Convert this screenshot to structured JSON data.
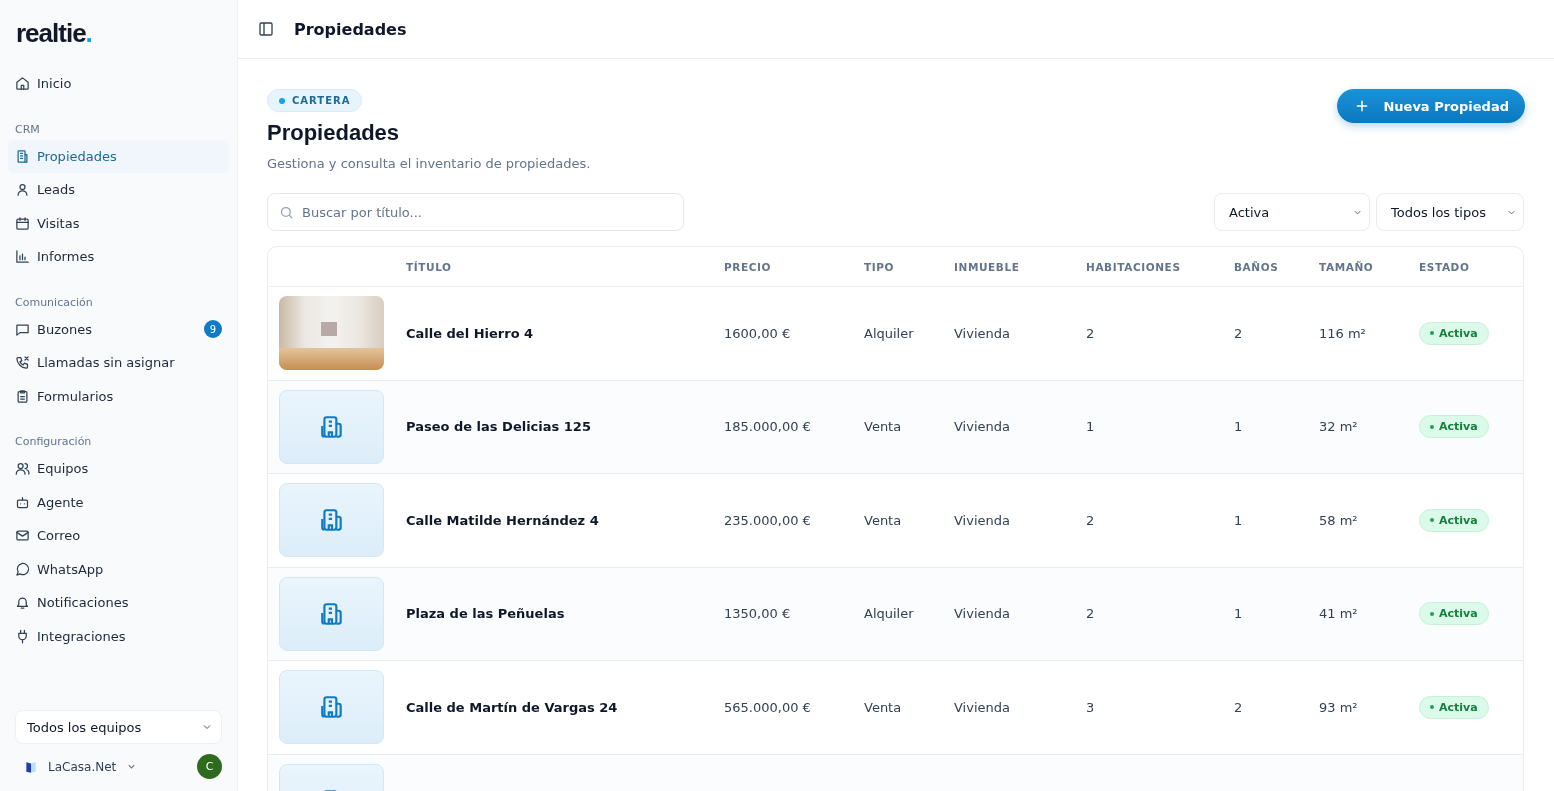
{
  "sidebar": {
    "logo": "realtie",
    "logo_dot": ".",
    "sections": [
      {
        "items": [
          {
            "label": "Inicio",
            "selected": false
          }
        ]
      },
      {
        "heading": "CRM",
        "items": [
          {
            "label": "Propiedades",
            "selected": true
          },
          {
            "label": "Leads",
            "selected": false
          },
          {
            "label": "Visitas",
            "selected": false
          },
          {
            "label": "Informes",
            "selected": false
          }
        ]
      },
      {
        "heading": "Comunicación",
        "items": [
          {
            "label": "Buzones",
            "selected": false,
            "badge": "9"
          },
          {
            "label": "Llamadas sin asignar",
            "selected": false
          },
          {
            "label": "Formularios",
            "selected": false
          }
        ]
      },
      {
        "heading": "Configuración",
        "items": [
          {
            "label": "Equipos",
            "selected": false
          },
          {
            "label": "Agente",
            "selected": false
          },
          {
            "label": "Correo",
            "selected": false
          },
          {
            "label": "WhatsApp",
            "selected": false
          },
          {
            "label": "Notificaciones",
            "selected": false
          },
          {
            "label": "Integraciones",
            "selected": false
          }
        ]
      }
    ],
    "team_select": {
      "value": "Todos los equipos"
    },
    "account": {
      "name": "LaCasa.Net",
      "avatar": "C"
    }
  },
  "header": {
    "title": "Propiedades"
  },
  "page": {
    "tag": "CARTERA",
    "title": "Propiedades",
    "subtitle": "Gestiona y consulta el inventario de propiedades.",
    "new_button": "Nueva Propiedad",
    "search": {
      "placeholder": "Buscar por título..."
    },
    "filters": [
      {
        "value": "Activa"
      },
      {
        "value": "Todos los tipos"
      }
    ]
  },
  "table": {
    "columns": [
      "TÍTULO",
      "PRECIO",
      "TIPO",
      "INMUEBLE",
      "HABITACIONES",
      "BAÑOS",
      "TAMAÑO",
      "ESTADO"
    ],
    "rows": [
      {
        "kind": "photo",
        "cells": [
          "Calle del Hierro 4",
          "1600,00 €",
          "Alquiler",
          "Vivienda",
          "2",
          "2",
          "116 m²"
        ],
        "status": "Activa"
      },
      {
        "kind": "placeholder",
        "cells": [
          "Paseo de las Delicias 125",
          "185.000,00 €",
          "Venta",
          "Vivienda",
          "1",
          "1",
          "32 m²"
        ],
        "status": "Activa"
      },
      {
        "kind": "placeholder",
        "cells": [
          "Calle Matilde Hernández 4",
          "235.000,00 €",
          "Venta",
          "Vivienda",
          "2",
          "1",
          "58 m²"
        ],
        "status": "Activa"
      },
      {
        "kind": "placeholder",
        "cells": [
          "Plaza de las Peñuelas",
          "1350,00 €",
          "Alquiler",
          "Vivienda",
          "2",
          "1",
          "41 m²"
        ],
        "status": "Activa"
      },
      {
        "kind": "placeholder",
        "cells": [
          "Calle de Martín de Vargas 24",
          "565.000,00 €",
          "Venta",
          "Vivienda",
          "3",
          "2",
          "93 m²"
        ],
        "status": "Activa"
      },
      {
        "kind": "placeholder",
        "cells": []
      }
    ]
  }
}
